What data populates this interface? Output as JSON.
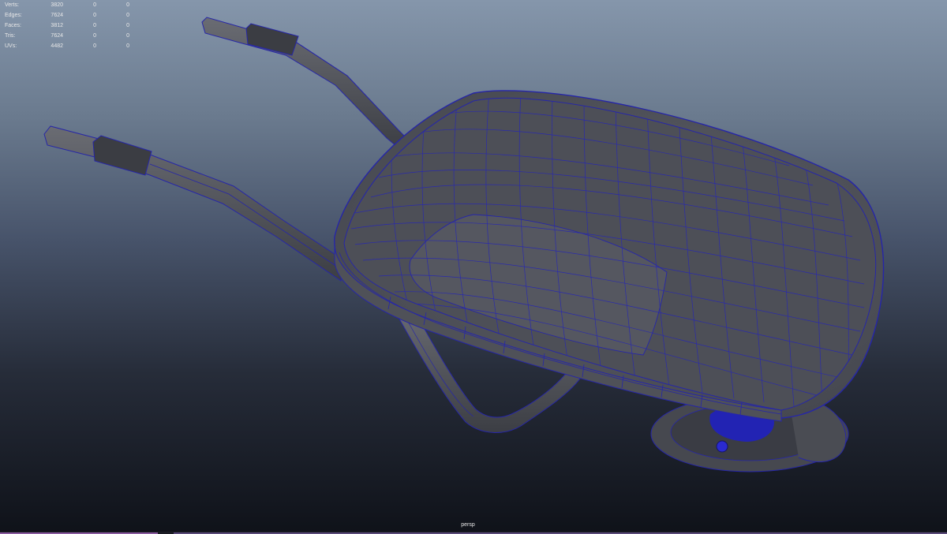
{
  "hud": {
    "rows": [
      {
        "label": "Verts:",
        "v1": "3820",
        "v2": "0",
        "v3": "0"
      },
      {
        "label": "Edges:",
        "v1": "7624",
        "v2": "0",
        "v3": "0"
      },
      {
        "label": "Faces:",
        "v1": "3812",
        "v2": "0",
        "v3": "0"
      },
      {
        "label": "Tris:",
        "v1": "7624",
        "v2": "0",
        "v3": "0"
      },
      {
        "label": "UVs:",
        "v1": "4482",
        "v2": "0",
        "v3": "0"
      }
    ]
  },
  "viewport": {
    "camera_label": "persp",
    "model_name": "wheelbarrow-wireframe",
    "colors": {
      "gradient_top": "#8596ab",
      "gradient_bottom": "#0f1219",
      "mesh_fill": "#55575e",
      "wireframe": "#2a2ab0",
      "accent": "#8a5aa0"
    }
  }
}
